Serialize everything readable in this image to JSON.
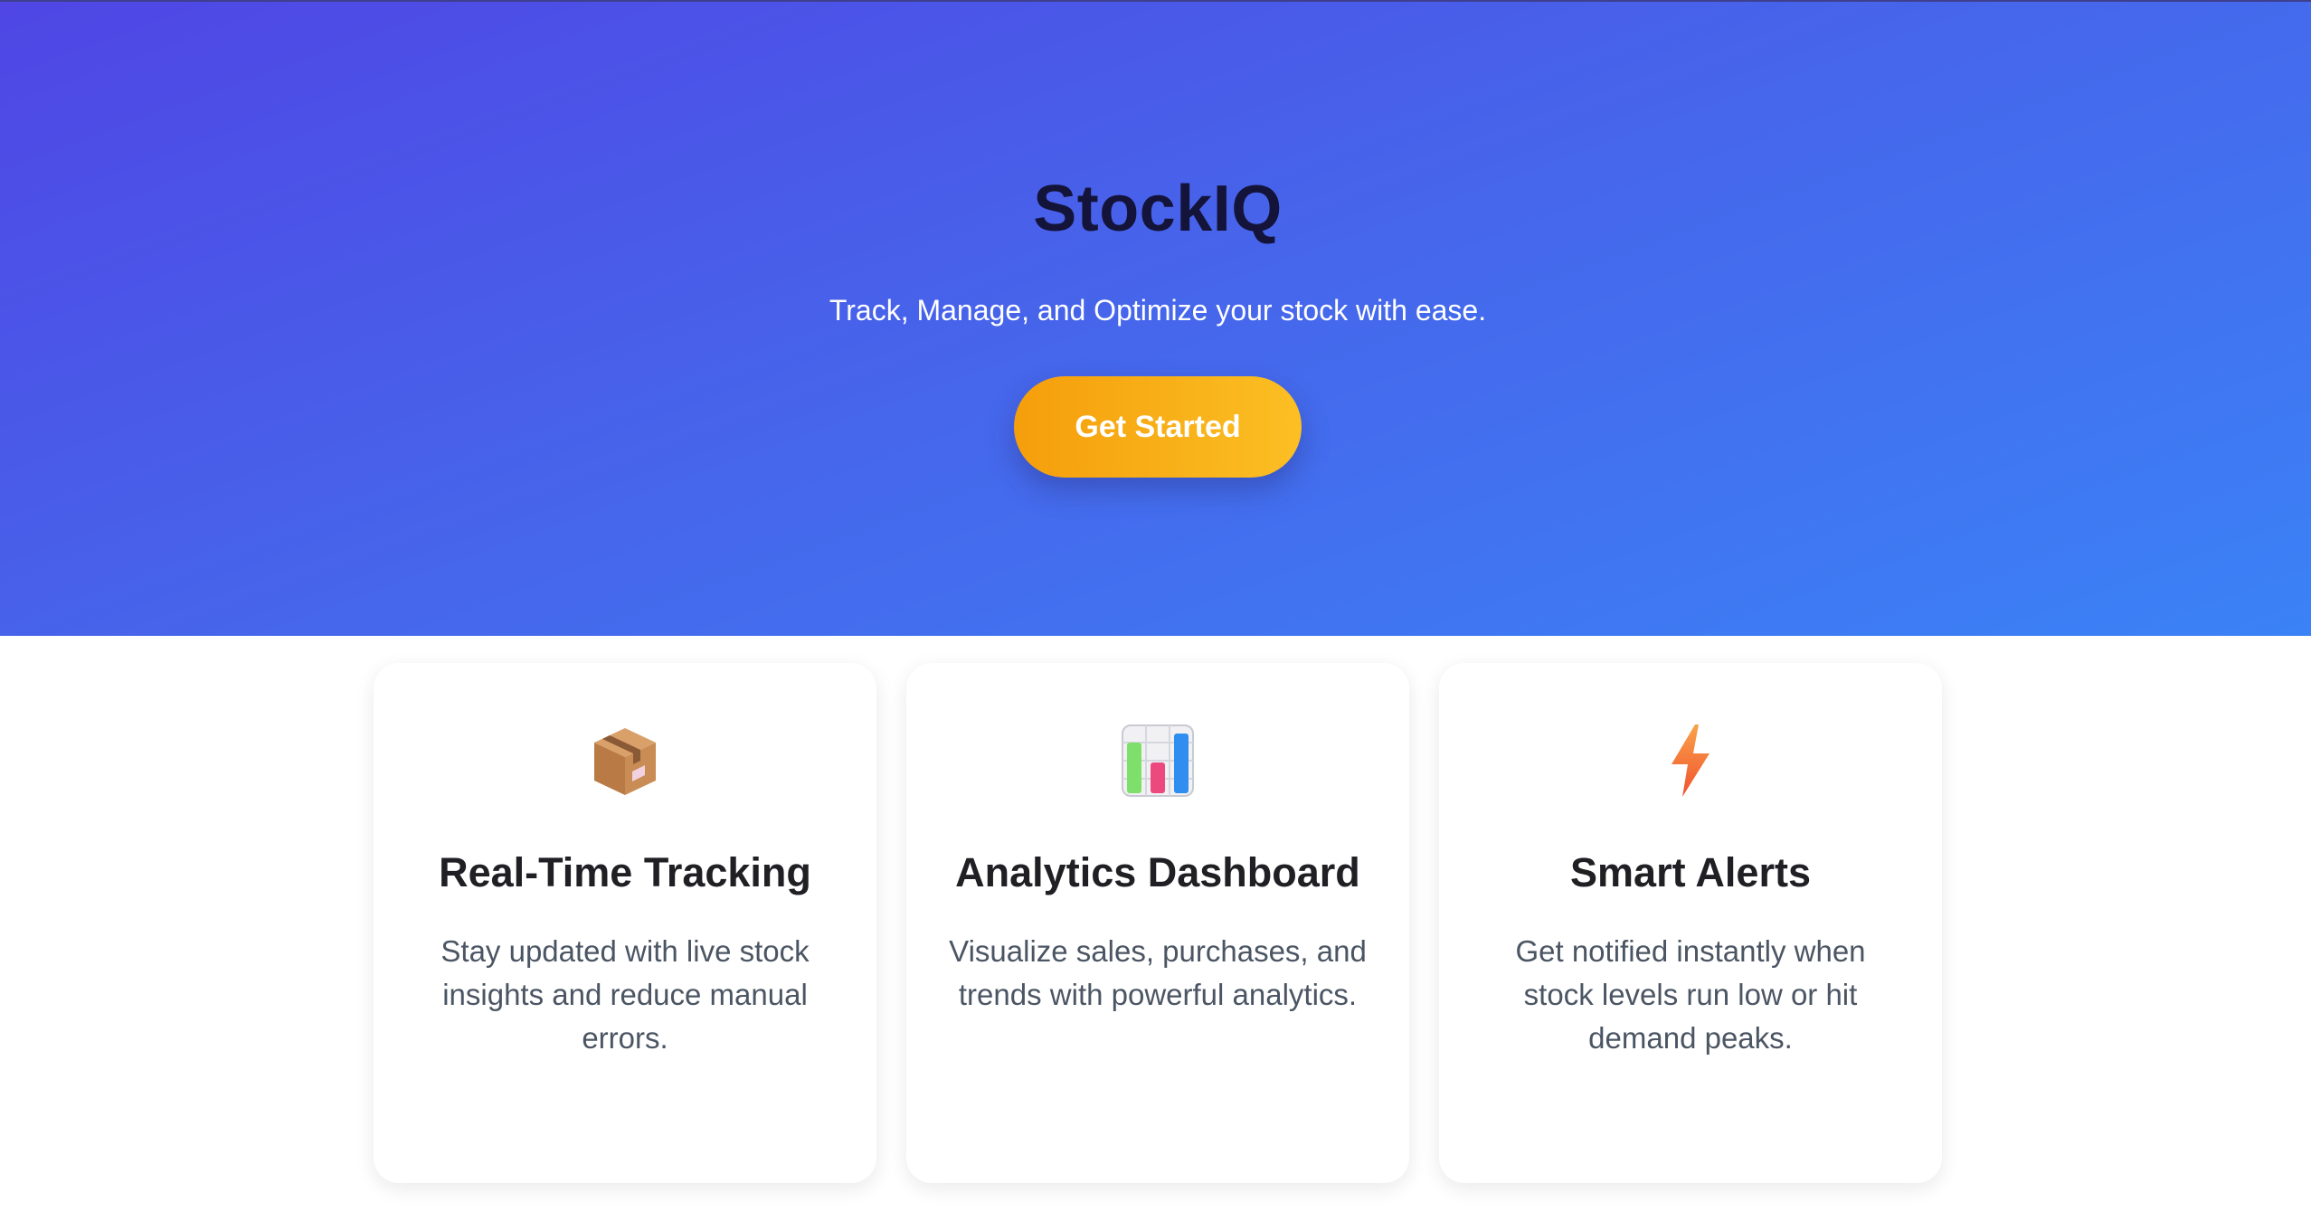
{
  "hero": {
    "title": "StockIQ",
    "subtitle": "Track, Manage, and Optimize your stock with ease.",
    "cta_label": "Get Started"
  },
  "features": [
    {
      "icon": "package-box-icon",
      "title": "Real-Time Tracking",
      "description": "Stay updated with live stock insights and reduce manual errors."
    },
    {
      "icon": "bar-chart-icon",
      "title": "Analytics Dashboard",
      "description": "Visualize sales, purchases, and trends with powerful analytics."
    },
    {
      "icon": "lightning-bolt-icon",
      "title": "Smart Alerts",
      "description": "Get notified instantly when stock levels run low or hit demand peaks."
    }
  ],
  "colors": {
    "hero_gradient_start": "#4f46e5",
    "hero_gradient_end": "#3b82f6",
    "cta_gradient_start": "#f59e0b",
    "cta_gradient_end": "#fbbf24",
    "title_color": "#14143a"
  }
}
